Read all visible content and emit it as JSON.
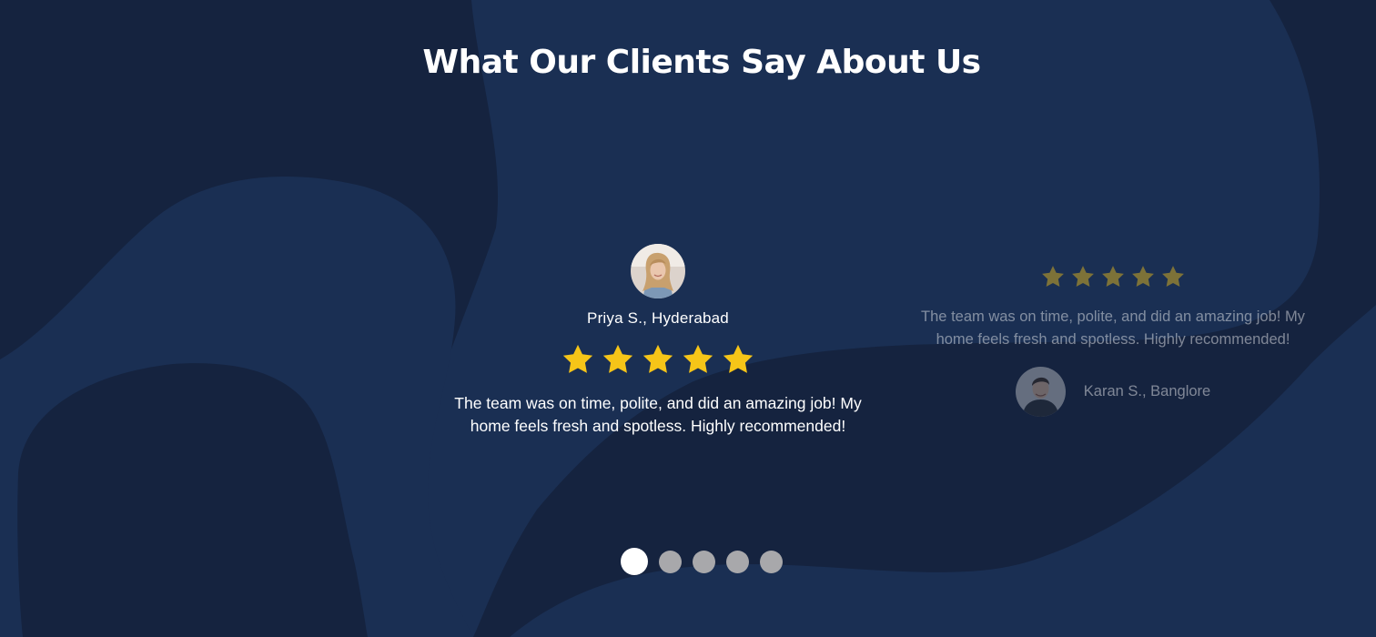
{
  "section": {
    "title": "What Our Clients Say About Us"
  },
  "colors": {
    "background": "#15233f",
    "blob": "#1a2f53",
    "star": "#f6c518",
    "dot_active": "#ffffff",
    "dot_inactive": "#a8a8ab"
  },
  "testimonials": [
    {
      "name": "Priya S., Hyderabad",
      "rating": 5,
      "review": "The team was on time, polite, and did an amazing job! My home feels fresh and spotless. Highly recommended!",
      "avatar_icon": "user-avatar-woman"
    },
    {
      "name": "Karan S., Banglore",
      "rating": 5,
      "review": "The team was on time, polite, and did an amazing job! My home feels fresh and spotless. Highly recommended!",
      "avatar_icon": "user-avatar-man"
    }
  ],
  "carousel": {
    "total_slides": 5,
    "active_index": 1
  }
}
